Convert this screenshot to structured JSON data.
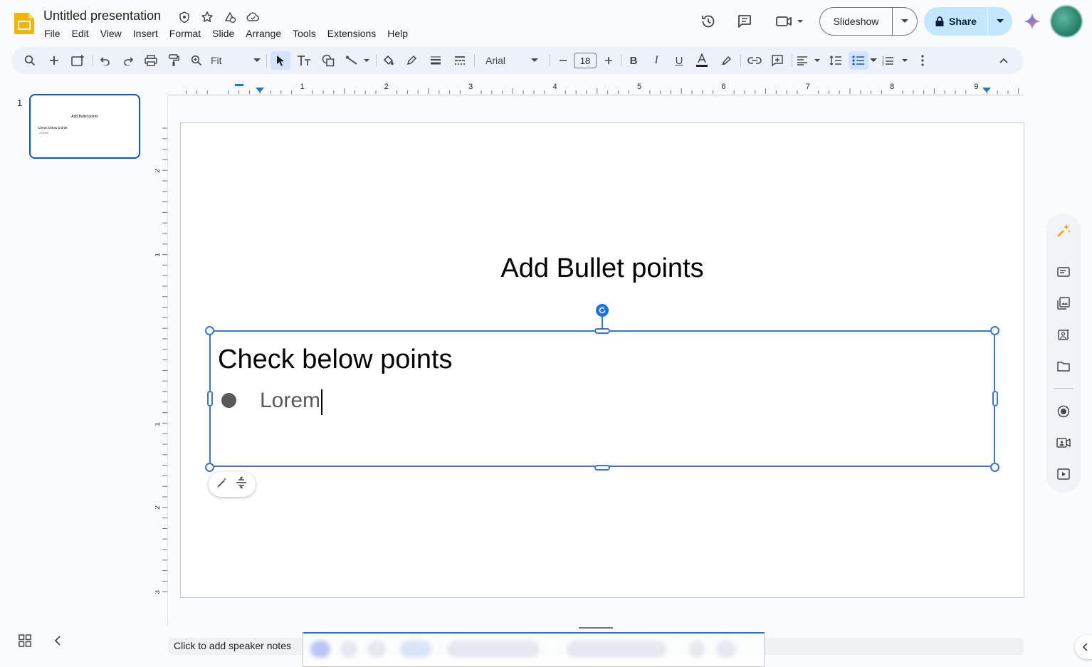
{
  "app": {
    "title": "Untitled presentation",
    "menu": [
      "File",
      "Edit",
      "View",
      "Insert",
      "Format",
      "Slide",
      "Arrange",
      "Tools",
      "Extensions",
      "Help"
    ]
  },
  "header": {
    "slideshow_label": "Slideshow",
    "share_label": "Share"
  },
  "toolbar": {
    "zoom": "Fit",
    "font": "Arial",
    "font_size": "18"
  },
  "filmstrip": {
    "slides": [
      {
        "number": "1",
        "title": "Add Bullet points",
        "subtitle": "Check below points",
        "bullet": "Lorem"
      }
    ]
  },
  "ruler": {
    "h_labels": [
      "1",
      "2",
      "3",
      "4",
      "5",
      "6",
      "7",
      "8",
      "9"
    ],
    "v_labels": [
      "2",
      "1",
      "1",
      "2",
      "3"
    ]
  },
  "slide": {
    "title": "Add Bullet points",
    "body_heading": "Check below points",
    "bullets": [
      "Lorem"
    ]
  },
  "notes": {
    "placeholder": "Click to add speaker notes"
  },
  "colors": {
    "accent": "#0b57d0",
    "selection": "#3a74d6",
    "share_bg": "#c2e7ff",
    "toolbar_bg": "#edf2fa"
  }
}
